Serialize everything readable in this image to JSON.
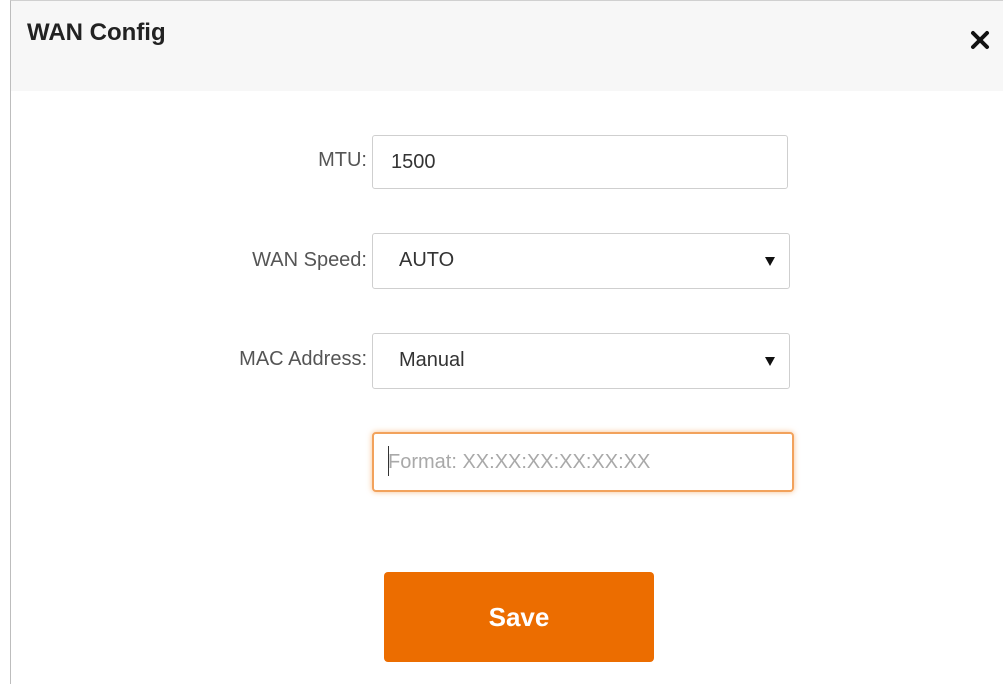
{
  "dialog": {
    "title": "WAN Config",
    "close_icon": "close-icon"
  },
  "form": {
    "mtu": {
      "label": "MTU:",
      "value": "1500"
    },
    "wan_speed": {
      "label": "WAN Speed:",
      "selected": "AUTO"
    },
    "mac_address": {
      "label": "MAC Address:",
      "selected": "Manual",
      "input_placeholder": "Format: XX:XX:XX:XX:XX:XX",
      "input_value": ""
    },
    "save_label": "Save"
  },
  "colors": {
    "accent": "#ec6d00",
    "focus_border": "#f2a25c",
    "header_bg": "#f7f7f7"
  }
}
